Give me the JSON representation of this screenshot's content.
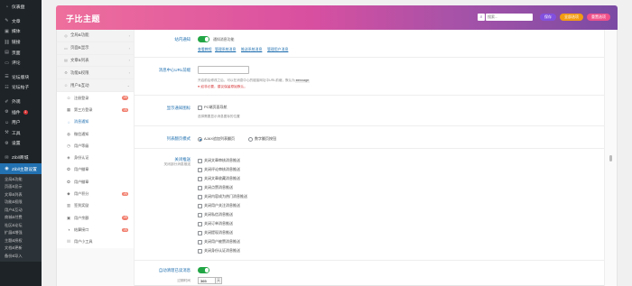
{
  "sidebar": {
    "items": [
      {
        "label": "仪表盘",
        "icon": "dashboard-icon"
      },
      {
        "label": "文章",
        "icon": "pin-icon"
      },
      {
        "label": "媒体",
        "icon": "media-icon"
      },
      {
        "label": "链接",
        "icon": "link-icon"
      },
      {
        "label": "页面",
        "icon": "page-icon"
      },
      {
        "label": "评论",
        "icon": "comment-icon"
      },
      {
        "label": "论坛版块",
        "icon": "forum-icon"
      },
      {
        "label": "论坛帖子",
        "icon": "topic-icon"
      },
      {
        "label": "外观",
        "icon": "appearance-icon"
      },
      {
        "label": "插件",
        "icon": "plugin-icon",
        "badge": "1"
      },
      {
        "label": "用户",
        "icon": "user-icon"
      },
      {
        "label": "工具",
        "icon": "tools-icon"
      },
      {
        "label": "设置",
        "icon": "settings-icon"
      },
      {
        "label": "Zibll商城",
        "icon": "shop-icon"
      },
      {
        "label": "Zibll主题设置",
        "icon": "theme-icon"
      }
    ],
    "subitems": [
      "全局&功能",
      "页面&显示",
      "文章&列表",
      "功能&权限",
      "用户&互动",
      "商城&付费",
      "社区&论坛",
      "扩展&增强",
      "主题&授权",
      "文档&更新",
      "备份&导入"
    ]
  },
  "header": {
    "title": "子比主题",
    "search_placeholder": "搜索...",
    "save_label": "保存",
    "import_label": "全部选项",
    "reset_label": "重置选项"
  },
  "options_nav": {
    "groups": [
      {
        "label": "全局&功能"
      },
      {
        "label": "页面&显示"
      },
      {
        "label": "文章&列表"
      },
      {
        "label": "功能&权限"
      },
      {
        "label": "用户&互动"
      }
    ],
    "subitems": [
      {
        "label": "注册登录",
        "icon": "user-icon",
        "badge": "V8"
      },
      {
        "label": "第三方登录",
        "icon": "grid-icon",
        "badge": "V8"
      },
      {
        "label": "消息通知",
        "icon": "bell-icon",
        "active": true
      },
      {
        "label": "微信通知",
        "icon": "wechat-icon"
      },
      {
        "label": "用户等级",
        "icon": "level-icon"
      },
      {
        "label": "身份认证",
        "icon": "badge-icon"
      },
      {
        "label": "用户徽章",
        "icon": "medal-icon"
      },
      {
        "label": "用户徽章",
        "icon": "medal-icon"
      },
      {
        "label": "用户积分",
        "icon": "points-icon",
        "badge": "V8"
      },
      {
        "label": "签到奖励",
        "icon": "gift-icon"
      },
      {
        "label": "用户余额",
        "icon": "wallet-icon",
        "badge": "V8"
      },
      {
        "label": "结算接口",
        "icon": "coin-icon",
        "badge": "V8"
      },
      {
        "label": "用户小工具",
        "icon": "tool-icon"
      }
    ]
  },
  "content": {
    "site_msg": {
      "label": "站内通知",
      "toggle_text": "通知消息功能",
      "links": [
        "查看教程",
        "管理系统消息",
        "推送系统消息",
        "管理用户消息"
      ]
    },
    "msg_url": {
      "label": "消息中心URL前缀",
      "value": "",
      "help_prefix": "开启前后修改之后，可以在消息中心的链接网址中URL前缀，默认为",
      "help_code": "message",
      "warning": "● 如非必要，建议保留原始默认。"
    },
    "float_badge": {
      "label": "显示通知图标",
      "checkbox_text": "PC端页面导航",
      "help": "选择需要显示消息图标的位置"
    },
    "list_mode": {
      "label": "列表翻页模式",
      "options": [
        "AJAX追加列表翻页",
        "数字翻页按钮"
      ],
      "selected": 0
    },
    "disable_msg": {
      "label": "关闭推送",
      "sublabel": "关闭部分消息推送",
      "options": [
        "关闭文章审核消息推送",
        "关闭评论审核消息推送",
        "关闭文章收藏消息推送",
        "关闭点赞消息推送",
        "关闭内容成为热门消息推送",
        "关闭用户关注消息推送",
        "关闭私信消息推送",
        "关闭订单消息推送",
        "关闭提现消息推送",
        "关闭用户被赞消息推送",
        "关闭身份认证消息推送"
      ]
    },
    "auto_clean": {
      "label": "自动清理已读消息",
      "sublabel": "过期时间",
      "value": "365",
      "unit": "天"
    }
  }
}
